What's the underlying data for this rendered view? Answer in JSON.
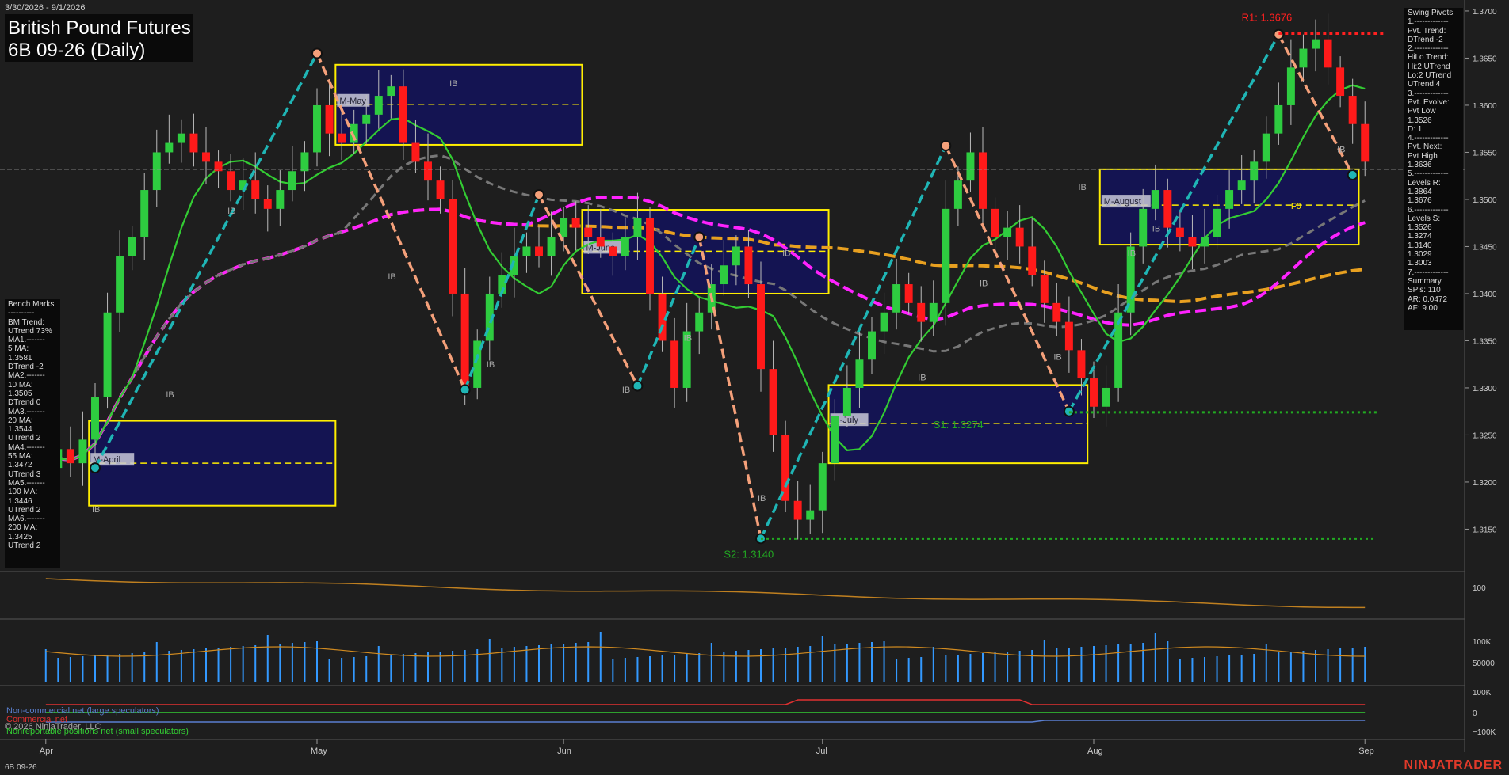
{
  "header": {
    "date_range": "3/30/2026 - 9/1/2026",
    "title": "British Pound Futures",
    "subtitle": "6B 09-26 (Daily)"
  },
  "footer": {
    "copyright": "© 2026 NinjaTrader, LLC",
    "instrument": "6B 09-26",
    "brand": "NINJATRADER"
  },
  "swing_panel": {
    "lines": [
      "Swing Pivots",
      "1.-------------",
      "Pvt. Trend:",
      "DTrend -2",
      "2.-------------",
      "HiLo Trend:",
      "Hi:2 UTrend",
      "Lo:2 UTrend",
      "UTrend 4",
      "3.-------------",
      "Pvt. Evolve:",
      "Pvt Low",
      "1.3526",
      "D: 1",
      "4.-------------",
      "Pvt. Next:",
      "Pvt High",
      "1.3636",
      "5.-------------",
      "Levels R:",
      "1.3864",
      "1.3676",
      "6.-------------",
      "Levels S:",
      "1.3526",
      "1.3274",
      "1.3140",
      "1.3029",
      "1.3003",
      "7.-------------",
      "Summary",
      "SP's: 110",
      "AR: 0.0472",
      "AF: 9.00"
    ]
  },
  "bench_panel": {
    "lines": [
      "Bench Marks",
      "----------",
      "BM Trend:",
      "UTrend 73%",
      "MA1.-------",
      "5 MA:",
      "1.3581",
      "DTrend -2",
      "MA2.-------",
      "10 MA:",
      "1.3505",
      "DTrend 0",
      "MA3.-------",
      "20 MA:",
      "1.3544",
      "UTrend 2",
      "MA4.-------",
      "55 MA:",
      "1.3472",
      "UTrend 3",
      "MA5.-------",
      "100 MA:",
      "1.3446",
      "UTrend 2",
      "MA6.-------",
      "200 MA:",
      "1.3425",
      "UTrend 2"
    ]
  },
  "legend": {
    "noncommercial": "Non-commercial net (large speculators)",
    "commercial": "Commercial net",
    "nonreportable": "Nonreportable positions net (small speculators)"
  },
  "colors": {
    "background": "#1e1e1e",
    "up_candle": "#2ecc40",
    "down_candle": "#ff1a1a",
    "cyan_swing": "#1fb5b5",
    "salmon_swing": "#f4a07a",
    "magenta_ma": "#ff22ff",
    "orange_ma": "#e8a020",
    "gray_ma": "#777777",
    "green_ma": "#33cc33",
    "box_fill": "#141452",
    "box_border": "#ffee00",
    "volume": "#3399ff",
    "noncommercial": "#5a7fd0",
    "commercial": "#e03030",
    "nonreportable": "#33cc33"
  },
  "chart_data": {
    "type": "candlestick",
    "title": "British Pound Futures",
    "subtitle": "6B 09-26 (Daily)",
    "price_axis": {
      "ylim": [
        1.3105,
        1.3705
      ],
      "ticks": [
        "1.3700",
        "1.3650",
        "1.3600",
        "1.3550",
        "1.3500",
        "1.3450",
        "1.3400",
        "1.3350",
        "1.3300",
        "1.3250",
        "1.3200",
        "1.3150"
      ]
    },
    "x_axis_labels": [
      {
        "label": "Apr",
        "bar": 0
      },
      {
        "label": "May",
        "bar": 22
      },
      {
        "label": "Jun",
        "bar": 42
      },
      {
        "label": "Jul",
        "bar": 63
      },
      {
        "label": "Aug",
        "bar": 85
      },
      {
        "label": "Sep",
        "bar": 107
      }
    ],
    "bars_count": 108,
    "candles_close": [
      1.3215,
      1.3235,
      1.322,
      1.3245,
      1.329,
      1.338,
      1.344,
      1.346,
      1.351,
      1.355,
      1.356,
      1.357,
      1.355,
      1.354,
      1.353,
      1.351,
      1.352,
      1.35,
      1.349,
      1.351,
      1.353,
      1.355,
      1.36,
      1.357,
      1.356,
      1.358,
      1.359,
      1.361,
      1.362,
      1.356,
      1.354,
      1.352,
      1.35,
      1.34,
      1.33,
      1.335,
      1.34,
      1.342,
      1.344,
      1.345,
      1.344,
      1.346,
      1.348,
      1.347,
      1.346,
      1.345,
      1.344,
      1.346,
      1.348,
      1.34,
      1.335,
      1.33,
      1.336,
      1.338,
      1.341,
      1.343,
      1.345,
      1.341,
      1.332,
      1.325,
      1.318,
      1.316,
      1.317,
      1.322,
      1.327,
      1.33,
      1.333,
      1.336,
      1.338,
      1.341,
      1.339,
      1.337,
      1.339,
      1.349,
      1.352,
      1.355,
      1.349,
      1.346,
      1.347,
      1.345,
      1.342,
      1.339,
      1.337,
      1.334,
      1.331,
      1.328,
      1.33,
      1.338,
      1.345,
      1.349,
      1.351,
      1.347,
      1.346,
      1.345,
      1.346,
      1.349,
      1.351,
      1.352,
      1.354,
      1.357,
      1.36,
      1.364,
      1.366,
      1.367,
      1.364,
      1.361,
      1.358,
      1.354
    ],
    "annotations": {
      "R1": {
        "label": "R1: 1.3676",
        "value": 1.3676
      },
      "S1": {
        "label": "S1: 1.3274",
        "value": 1.3274
      },
      "S2": {
        "label": "S2: 1.3140",
        "value": 1.314
      },
      "current_price": 1.3532
    },
    "monthly_boxes": [
      {
        "label": "M-April",
        "bar_start": 4,
        "bar_end": 23,
        "high": 1.3265,
        "low": 1.3175,
        "mid": 1.322
      },
      {
        "label": "M-May",
        "bar_start": 24,
        "bar_end": 43,
        "high": 1.3643,
        "low": 1.3558,
        "mid": 1.3601
      },
      {
        "label": "M-June",
        "bar_start": 44,
        "bar_end": 63,
        "high": 1.3489,
        "low": 1.34,
        "mid": 1.3445
      },
      {
        "label": "M-July",
        "bar_start": 64,
        "bar_end": 84,
        "high": 1.3303,
        "low": 1.322,
        "mid": 1.3262
      },
      {
        "label": "M-August",
        "bar_start": 86,
        "bar_end": 106,
        "high": 1.3532,
        "low": 1.3452,
        "mid": 1.3494
      }
    ],
    "swing_points": [
      {
        "bar": 4,
        "value": 1.3215
      },
      {
        "bar": 22,
        "value": 1.3655
      },
      {
        "bar": 34,
        "value": 1.3298
      },
      {
        "bar": 40,
        "value": 1.3505
      },
      {
        "bar": 48,
        "value": 1.3302
      },
      {
        "bar": 53,
        "value": 1.346
      },
      {
        "bar": 58,
        "value": 1.314
      },
      {
        "bar": 73,
        "value": 1.3557
      },
      {
        "bar": 83,
        "value": 1.3275
      },
      {
        "bar": 100,
        "value": 1.3675
      },
      {
        "bar": 106,
        "value": 1.3526
      }
    ],
    "ib_labels": [
      "IB",
      "IB",
      "IB",
      "IB",
      "IB",
      "IB",
      "IB",
      "IB",
      "IB",
      "IB",
      "IB",
      "IB",
      "IB",
      "IB",
      "IB",
      "IB",
      "IB"
    ],
    "volume_axis": {
      "ticks": [
        "100K",
        "50000"
      ]
    },
    "cot_axis": {
      "ticks": [
        "100K",
        "0",
        "−100K"
      ]
    },
    "osc_axis": {
      "ticks": [
        "100"
      ]
    },
    "f0_label": "F0"
  }
}
